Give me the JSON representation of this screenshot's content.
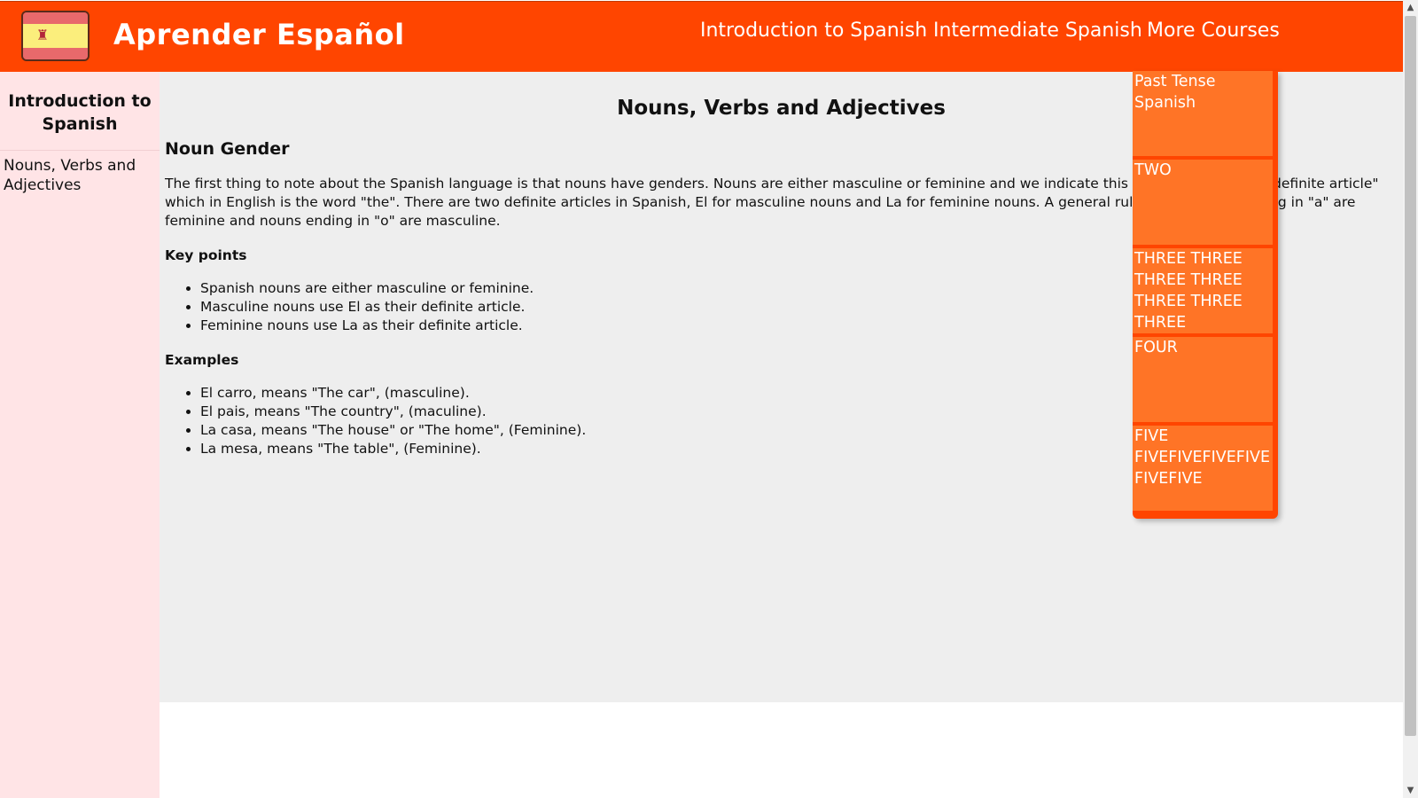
{
  "header": {
    "brand": "Aprender Español",
    "logo_icon": "spain-flag-icon",
    "nav": [
      "Introduction to Spanish",
      "Intermediate Spanish",
      "More Courses"
    ],
    "background_color": "#ff4500"
  },
  "sidebar": {
    "title": "Introduction to Spanish",
    "items": [
      "Nouns, Verbs and Adjectives"
    ],
    "background_color": "#ffe4e6"
  },
  "main": {
    "title": "Nouns, Verbs and Adjectives",
    "section_heading": "Noun Gender",
    "paragraph": "The first thing to note about the Spanish language is that nouns have genders. Nouns are either masculine or feminine and we indicate this difference with the \"definite article\" which in English is the word \"the\". There are two definite articles in Spanish, El for masculine nouns and La for feminine nouns. A general rule is that nouns ending in \"a\" are feminine and nouns ending in \"o\" are masculine.",
    "key_points_heading": "Key points",
    "key_points": [
      "Spanish nouns are either masculine or feminine.",
      "Masculine nouns use El as their definite article.",
      "Feminine nouns use La as their definite article."
    ],
    "examples_heading": "Examples",
    "examples": [
      "El carro, means \"The car\", (masculine).",
      "El pais, means \"The country\", (maculine).",
      "La casa, means \"The house\" or \"The home\", (Feminine).",
      "La mesa, means \"The table\", (Feminine)."
    ]
  },
  "dropdown": {
    "items": [
      "Past Tense Spanish",
      "TWO",
      "THREE THREE THREE THREE THREE THREE THREE",
      "FOUR",
      "FIVE FIVEFIVEFIVEFIVEFIVEFIVE"
    ],
    "item_color": "#ff7426"
  },
  "scrollbar": {
    "up_icon": "arrow-up-icon",
    "down_icon": "arrow-down-icon"
  }
}
